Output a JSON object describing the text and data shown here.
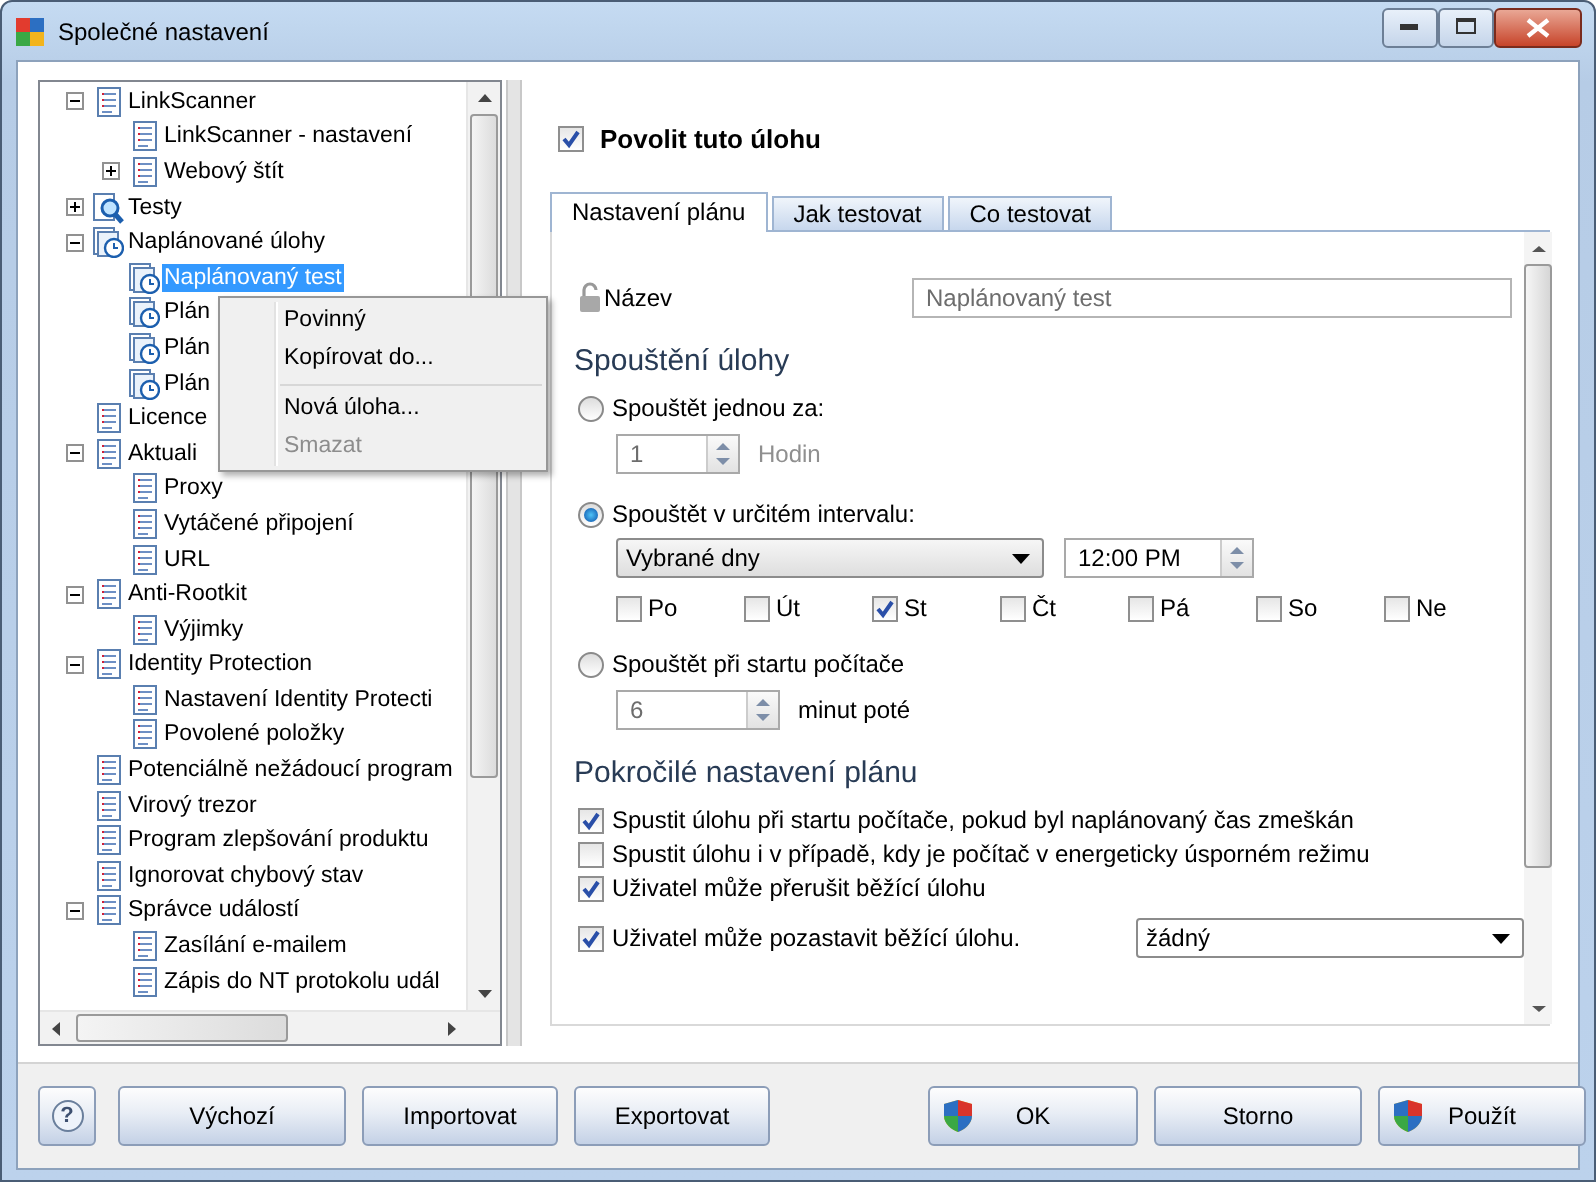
{
  "window": {
    "title": "Společné nastavení"
  },
  "tree": {
    "items": [
      {
        "label": "LinkScanner",
        "kind": "doc",
        "expanded": true,
        "selected": false,
        "children": [
          {
            "label": "LinkScanner - nastavení",
            "kind": "doc",
            "selected": false
          },
          {
            "label": "Webový štít",
            "kind": "doc",
            "expanded": false,
            "selected": false
          }
        ]
      },
      {
        "label": "Testy",
        "kind": "scan",
        "expanded": false,
        "selected": false
      },
      {
        "label": "Naplánované úlohy",
        "kind": "task",
        "expanded": true,
        "selected": false,
        "children": [
          {
            "label": "Naplánovaný test",
            "kind": "task",
            "selected": true
          },
          {
            "label": "Plán",
            "kind": "task",
            "selected": false
          },
          {
            "label": "Plán",
            "kind": "task",
            "selected": false
          },
          {
            "label": "Plán",
            "kind": "task",
            "selected": false
          }
        ]
      },
      {
        "label": "Licence",
        "kind": "doc",
        "selected": false
      },
      {
        "label": "Aktuali",
        "kind": "doc",
        "expanded": true,
        "selected": false,
        "children": [
          {
            "label": "Proxy",
            "kind": "doc",
            "selected": false
          },
          {
            "label": "Vytáčené připojení",
            "kind": "doc",
            "selected": false
          },
          {
            "label": "URL",
            "kind": "doc",
            "selected": false
          }
        ]
      },
      {
        "label": "Anti-Rootkit",
        "kind": "doc",
        "expanded": true,
        "selected": false,
        "children": [
          {
            "label": "Výjimky",
            "kind": "doc",
            "selected": false
          }
        ]
      },
      {
        "label": "Identity Protection",
        "kind": "doc",
        "expanded": true,
        "selected": false,
        "children": [
          {
            "label": "Nastavení Identity Protecti",
            "kind": "doc",
            "selected": false
          },
          {
            "label": "Povolené položky",
            "kind": "doc",
            "selected": false
          }
        ]
      },
      {
        "label": "Potenciálně nežádoucí program",
        "kind": "doc",
        "selected": false
      },
      {
        "label": "Virový trezor",
        "kind": "doc",
        "selected": false
      },
      {
        "label": "Program zlepšování produktu",
        "kind": "doc",
        "selected": false
      },
      {
        "label": "Ignorovat chybový stav",
        "kind": "doc",
        "selected": false
      },
      {
        "label": "Správce událostí",
        "kind": "doc",
        "expanded": true,
        "selected": false,
        "children": [
          {
            "label": "Zasílání e-mailem",
            "kind": "doc",
            "selected": false
          },
          {
            "label": "Zápis do NT protokolu udál",
            "kind": "doc",
            "selected": false
          }
        ]
      }
    ]
  },
  "context_menu": {
    "items": [
      {
        "kind": "item",
        "label": "Povinný",
        "disabled": false
      },
      {
        "kind": "item",
        "label": "Kopírovat do...",
        "disabled": false
      },
      {
        "kind": "separator"
      },
      {
        "kind": "item",
        "label": "Nová úloha...",
        "disabled": false
      },
      {
        "kind": "item",
        "label": "Smazat",
        "disabled": true
      }
    ]
  },
  "enable_task": {
    "label": "Povolit tuto úlohu",
    "checked": true
  },
  "tabs": [
    {
      "label": "Nastavení plánu",
      "selected": true
    },
    {
      "label": "Jak testovat",
      "selected": false
    },
    {
      "label": "Co testovat",
      "selected": false
    }
  ],
  "name_field": {
    "label": "Název",
    "value": "Naplánovaný test"
  },
  "schedule": {
    "title": "Spouštění úlohy",
    "options": [
      {
        "kind": "once",
        "label": "Spouštět jednou za:",
        "selected": false,
        "spin": {
          "value": "1",
          "disabled": true
        },
        "unit": {
          "text": "Hodin",
          "disabled": true
        }
      },
      {
        "kind": "interval",
        "label": "Spouštět v určitém intervalu:",
        "selected": true,
        "dropdown": "Vybrané dny",
        "time": "12:00 PM",
        "days": [
          {
            "label": "Po",
            "checked": false
          },
          {
            "label": "Út",
            "checked": false
          },
          {
            "label": "St",
            "checked": true
          },
          {
            "label": "Čt",
            "checked": false
          },
          {
            "label": "Pá",
            "checked": false
          },
          {
            "label": "So",
            "checked": false
          },
          {
            "label": "Ne",
            "checked": false
          }
        ]
      },
      {
        "kind": "startup",
        "label": "Spouštět při startu počítače",
        "selected": false,
        "spin": {
          "value": "6",
          "disabled": true
        },
        "unit": {
          "text": "minut poté",
          "disabled": false
        }
      }
    ]
  },
  "advanced": {
    "title": "Pokročilé nastavení plánu",
    "options": [
      {
        "label": "Spustit úlohu při startu počítače, pokud byl naplánovaný čas zmeškán",
        "checked": true
      },
      {
        "label": "Spustit úlohu i v případě, kdy je počítač v energeticky úsporném režimu",
        "checked": false
      },
      {
        "label": "Uživatel může přerušit běžící úlohu",
        "checked": true
      },
      {
        "label": "Uživatel může pozastavit běžící úlohu.",
        "checked": true,
        "dropdown": "žádný"
      }
    ]
  },
  "buttons": [
    {
      "kind": "help",
      "label": "?"
    },
    {
      "kind": "plain",
      "label": "Výchozí",
      "shield": false
    },
    {
      "kind": "plain",
      "label": "Importovat",
      "shield": false
    },
    {
      "kind": "plain",
      "label": "Exportovat",
      "shield": false
    },
    {
      "kind": "gap"
    },
    {
      "kind": "plain",
      "label": "OK",
      "shield": true
    },
    {
      "kind": "plain",
      "label": "Storno",
      "shield": false
    },
    {
      "kind": "plain",
      "label": "Použít",
      "shield": true
    }
  ]
}
